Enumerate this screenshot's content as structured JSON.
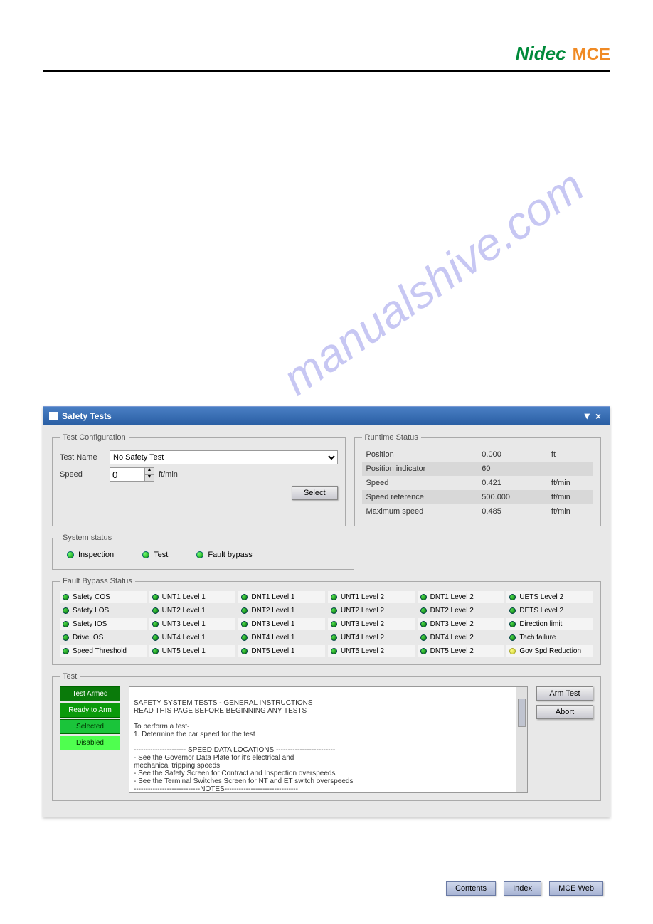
{
  "logos": {
    "nidec": "Nidec",
    "mce": "MCE"
  },
  "watermark": "manualshive.com",
  "window": {
    "title": "Safety Tests",
    "minimize": "▾",
    "close": "×"
  },
  "test_config": {
    "legend": "Test Configuration",
    "name_label": "Test Name",
    "name_value": "No Safety Test",
    "speed_label": "Speed",
    "speed_value": "0",
    "speed_unit": "ft/min",
    "select_btn": "Select"
  },
  "runtime": {
    "legend": "Runtime Status",
    "rows": [
      {
        "label": "Position",
        "value": "0.000",
        "unit": "ft"
      },
      {
        "label": "Position indicator",
        "value": "60",
        "unit": ""
      },
      {
        "label": "Speed",
        "value": "0.421",
        "unit": "ft/min"
      },
      {
        "label": "Speed reference",
        "value": "500.000",
        "unit": "ft/min"
      },
      {
        "label": "Maximum speed",
        "value": "0.485",
        "unit": "ft/min"
      }
    ]
  },
  "system_status": {
    "legend": "System status",
    "items": [
      "Inspection",
      "Test",
      "Fault bypass"
    ]
  },
  "fault_bypass": {
    "legend": "Fault Bypass Status",
    "items": [
      "Safety COS",
      "UNT1 Level 1",
      "DNT1 Level 1",
      "UNT1 Level 2",
      "DNT1 Level 2",
      "UETS Level 2",
      "Safety LOS",
      "UNT2 Level 1",
      "DNT2 Level 1",
      "UNT2 Level 2",
      "DNT2 Level 2",
      "DETS Level 2",
      "Safety IOS",
      "UNT3 Level 1",
      "DNT3 Level 1",
      "UNT3 Level 2",
      "DNT3 Level 2",
      "Direction limit",
      "Drive IOS",
      "UNT4 Level 1",
      "DNT4 Level 1",
      "UNT4 Level 2",
      "DNT4 Level 2",
      "Tach failure",
      "Speed Threshold",
      "UNT5 Level 1",
      "DNT5 Level 1",
      "UNT5 Level 2",
      "DNT5 Level 2",
      "Gov Spd Reduction"
    ]
  },
  "test_panel": {
    "legend": "Test",
    "statuses": {
      "armed": "Test Armed",
      "ready": "Ready to Arm",
      "selected": "Selected",
      "disabled": "Disabled"
    },
    "instructions": "SAFETY SYSTEM TESTS - GENERAL INSTRUCTIONS\nREAD THIS PAGE BEFORE BEGINNING ANY TESTS\n\nTo perform a test-\n 1. Determine the car speed for the test\n\n---------------------- SPEED DATA LOCATIONS -------------------------\n - See the Governor Data Plate for it's electrical and\n   mechanical tripping speeds\n - See the Safety Screen for Contract and Inspection overspeeds\n - See the Terminal Switches Screen for NT and ET switch overspeeds\n----------------------------NOTES-------------------------------",
    "arm_btn": "Arm Test",
    "abort_btn": "Abort"
  },
  "footer": {
    "contents": "Contents",
    "index": "Index",
    "web": "MCE Web"
  }
}
